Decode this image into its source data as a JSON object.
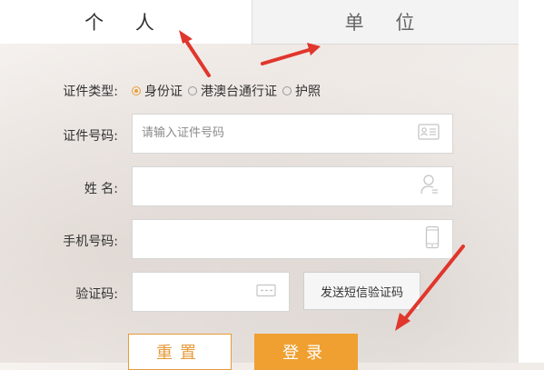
{
  "tabs": {
    "personal": "个 人",
    "unit": "单 位"
  },
  "form": {
    "id_type_label": "证件类型:",
    "id_types": [
      {
        "label": "身份证",
        "selected": true
      },
      {
        "label": "港澳台通行证",
        "selected": false
      },
      {
        "label": "护照",
        "selected": false
      }
    ],
    "id_number_label": "证件号码:",
    "id_number_placeholder": "请输入证件号码",
    "name_label": "姓 名:",
    "phone_label": "手机号码:",
    "code_label": "验证码:",
    "sms_button": "发送短信验证码",
    "reset_button": "重置",
    "login_button": "登录"
  },
  "icons": {
    "id_card": "id-card-icon",
    "user": "user-icon",
    "phone": "mobile-phone-icon",
    "captcha": "captcha-icon"
  },
  "colors": {
    "accent": "#f0a030",
    "annotation": "#e0362c"
  }
}
